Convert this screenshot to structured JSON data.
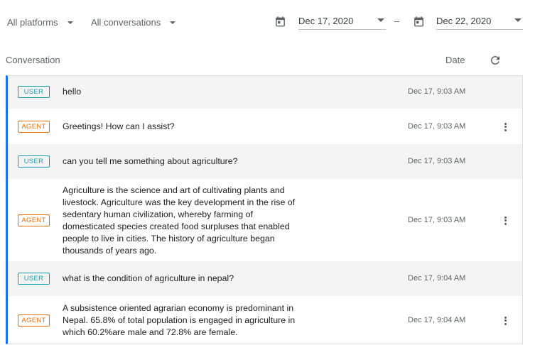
{
  "filters": {
    "platform": "All platforms",
    "conversation": "All conversations",
    "date_from": "Dec 17, 2020",
    "date_separator": "–",
    "date_to": "Dec 22, 2020"
  },
  "columns": {
    "conversation": "Conversation",
    "date": "Date"
  },
  "icons": {
    "calendar": "calendar-icon",
    "refresh": "refresh-icon",
    "more": "more-vert-icon"
  },
  "colors": {
    "accent": "#1a73e8",
    "user_badge": "#129eaf",
    "agent_badge": "#e8710a"
  },
  "messages": [
    {
      "role": "USER",
      "text": "hello",
      "time": "Dec 17, 9:03 AM"
    },
    {
      "role": "AGENT",
      "text": "Greetings! How can I assist?",
      "time": "Dec 17, 9:03 AM"
    },
    {
      "role": "USER",
      "text": "can you tell me something about agriculture?",
      "time": "Dec 17, 9:03 AM"
    },
    {
      "role": "AGENT",
      "text": "Agriculture is the science and art of cultivating plants and livestock. Agriculture was the key development in the rise of sedentary human civilization, whereby farming of domesticated species created food surpluses that enabled people to live in cities. The history of agriculture began thousands of years ago.",
      "time": "Dec 17, 9:03 AM"
    },
    {
      "role": "USER",
      "text": "what is the condition of agriculture in nepal?",
      "time": "Dec 17, 9:04 AM"
    },
    {
      "role": "AGENT",
      "text": "A subsistence oriented agrarian economy is predominant in Nepal. 65.8% of total population is engaged in agriculture in which 60.2%are male and 72.8% are female.",
      "time": "Dec 17, 9:04 AM"
    }
  ]
}
